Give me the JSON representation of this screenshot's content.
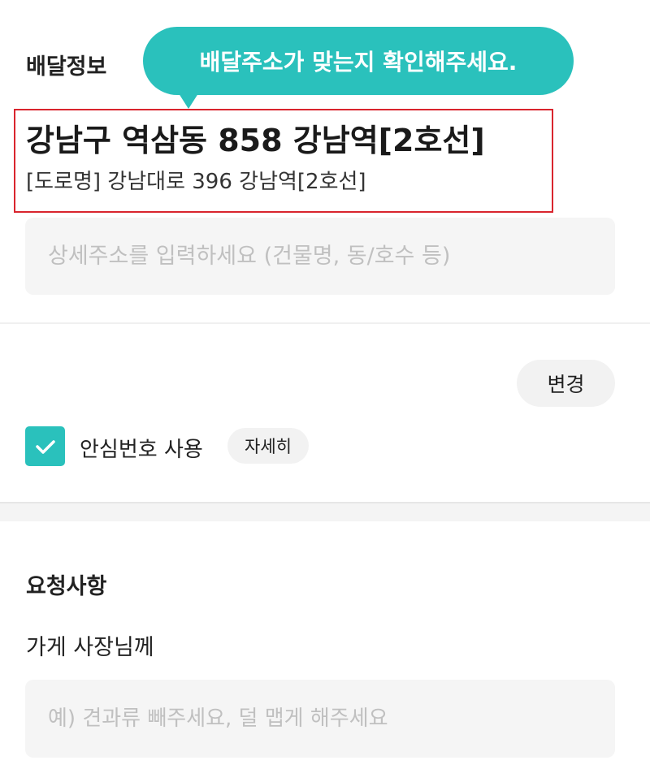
{
  "delivery": {
    "section_title": "배달정보",
    "tooltip": "배달주소가 맞는지 확인해주세요.",
    "address_main": "강남구 역삼동 858 강남역[2호선]",
    "address_road": "[도로명] 강남대로 396 강남역[2호선]",
    "detail_placeholder": "상세주소를 입력하세요 (건물명, 동/호수 등)",
    "change_button": "변경",
    "safe_number_label": "안심번호 사용",
    "safe_number_checked": true,
    "detail_chip": "자세히"
  },
  "request": {
    "section_title": "요청사항",
    "owner_label": "가게 사장님께",
    "owner_placeholder": "예) 견과류 빼주세요, 덜 맵게 해주세요"
  },
  "colors": {
    "accent": "#2ac1bc",
    "highlight_border": "#d9252e"
  },
  "icons": {
    "checkbox": "check-icon"
  }
}
